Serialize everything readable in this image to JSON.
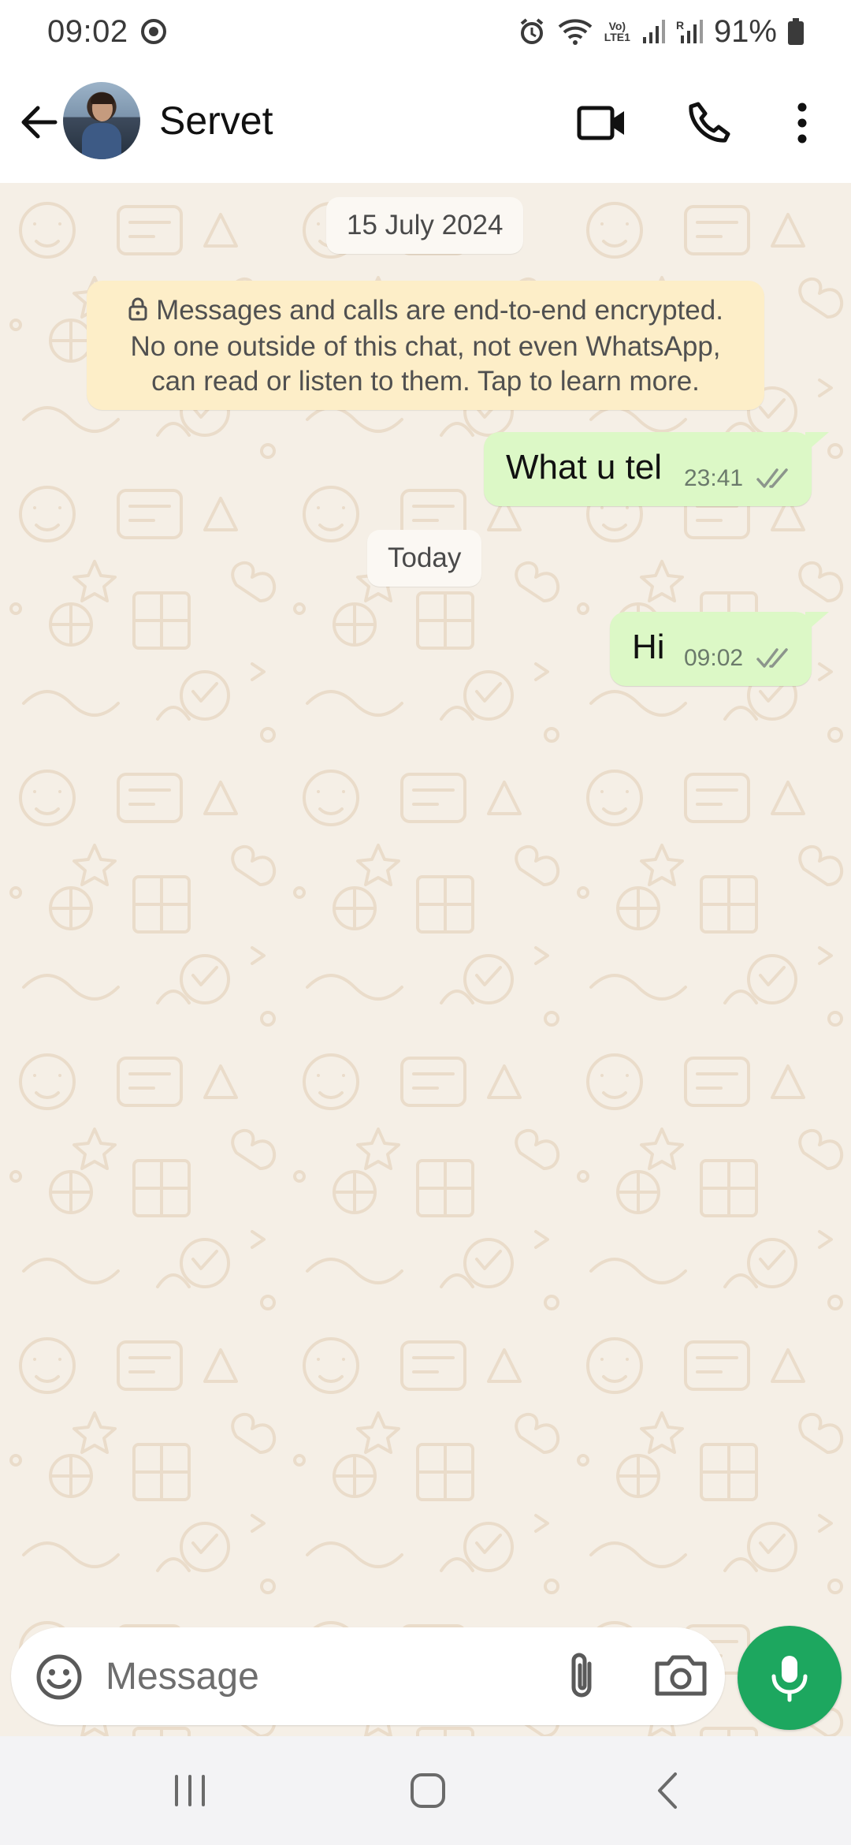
{
  "status_bar": {
    "time": "09:02",
    "battery_percent": "91%",
    "network_badge_top": "Vo)",
    "network_badge_bottom": "LTE1",
    "sim_label": "R"
  },
  "header": {
    "contact_name": "Servet",
    "icons": [
      "back-arrow-icon",
      "video-call-icon",
      "phone-icon",
      "more-options-icon"
    ]
  },
  "chat": {
    "date_chips": [
      "15 July 2024",
      "Today"
    ],
    "encryption_notice": {
      "line1": "Messages and calls are end-to-end encrypted.",
      "line2": "No one outside of this chat, not even WhatsApp,",
      "line3": "can read or listen to them. Tap to learn more."
    },
    "messages": [
      {
        "text": "What u tel",
        "time": "23:41",
        "status": "read"
      },
      {
        "text": "Hi",
        "time": "09:02",
        "status": "read"
      }
    ]
  },
  "composer": {
    "placeholder": "Message"
  },
  "colors": {
    "outgoing_bubble": "#dcf8c6",
    "notice_bg": "#fdeec8",
    "mic_button": "#1da75f",
    "chat_bg": "#f5efe6"
  }
}
